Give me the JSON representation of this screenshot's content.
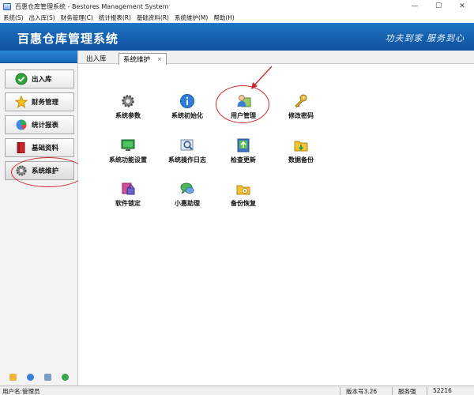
{
  "window": {
    "title": "百惠仓库管理系统 - Bestores Management System",
    "controls": {
      "minimize": "—",
      "maximize": "☐",
      "close": "✕"
    }
  },
  "menu": [
    "系统(S)",
    "出入库(S)",
    "财务管理(C)",
    "统计报表(R)",
    "基础资料(R)",
    "系统维护(M)",
    "帮助(H)"
  ],
  "banner": {
    "brand": "百惠仓库管理系统",
    "slogan": "功夫到家 服务到心"
  },
  "sidebar": {
    "items": [
      {
        "label": "出入库",
        "icon": "check-circle-icon"
      },
      {
        "label": "财务管理",
        "icon": "star-icon"
      },
      {
        "label": "统计报表",
        "icon": "pie-chart-icon"
      },
      {
        "label": "基础资料",
        "icon": "book-icon"
      },
      {
        "label": "系统维护",
        "icon": "gear-icon",
        "active": true
      }
    ]
  },
  "tabs": {
    "inactive": "出入库",
    "active": "系统维护",
    "close": "×"
  },
  "functions": [
    {
      "label": "系统参数",
      "icon": "gear-icon"
    },
    {
      "label": "系统初始化",
      "icon": "info-icon"
    },
    {
      "label": "用户管理",
      "icon": "user-icon"
    },
    {
      "label": "修改密码",
      "icon": "key-icon"
    },
    {
      "label": "系统功能设置",
      "icon": "monitor-icon"
    },
    {
      "label": "系统操作日志",
      "icon": "log-search-icon"
    },
    {
      "label": "检查更新",
      "icon": "update-icon"
    },
    {
      "label": "数据备份",
      "icon": "backup-folder-icon"
    },
    {
      "label": "软件锁定",
      "icon": "lock-icon"
    },
    {
      "label": "小惠助理",
      "icon": "chat-icon"
    },
    {
      "label": "备份恢复",
      "icon": "restore-icon"
    }
  ],
  "status": {
    "user": "用户名:管理员",
    "version": "版本号3.26",
    "service_label": "服务强",
    "service_value": "52216"
  },
  "colors": {
    "banner": "#1560ad",
    "annotation": "#cc2a2a"
  }
}
